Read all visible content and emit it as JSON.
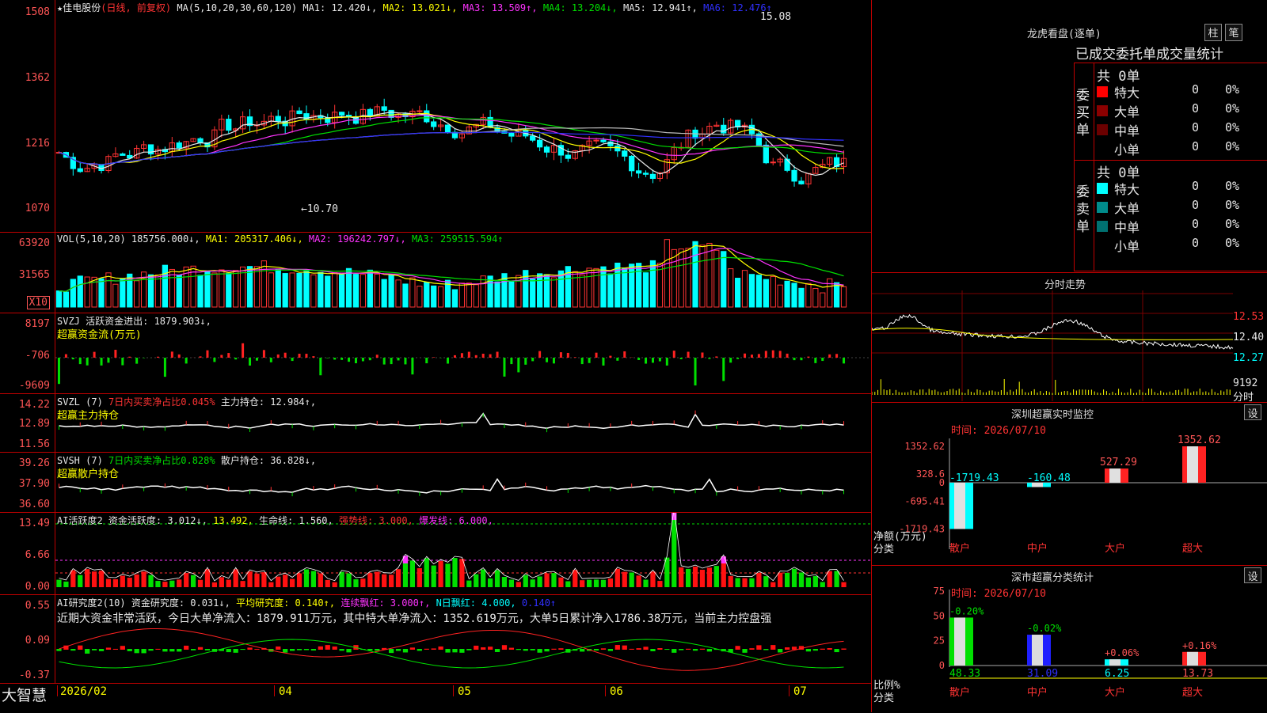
{
  "app": {
    "name": "大智慧"
  },
  "stock": {
    "star": "★",
    "name": "佳电股份",
    "mode": "(日线, 前复权)"
  },
  "ma_header": [
    {
      "text": "MA(5,10,20,30,60,120)",
      "color": "#e8e8e8"
    },
    {
      "text": "MA1: 12.420↓,",
      "color": "#e8e8e8"
    },
    {
      "text": "MA2: 13.021↓,",
      "color": "#ffff00"
    },
    {
      "text": "MA3: 13.509↑,",
      "color": "#ff33ff"
    },
    {
      "text": "MA4: 13.204↓,",
      "color": "#00e000"
    },
    {
      "text": "MA5: 12.941↑,",
      "color": "#e8e8e8"
    },
    {
      "text": "MA6: 12.476↑",
      "color": "#3030ff"
    }
  ],
  "price_axis": [
    "1508",
    "1362",
    "1216",
    "1070"
  ],
  "annotations": {
    "high": "15.08",
    "low": "←10.70"
  },
  "vol_header": [
    {
      "text": "VOL(5,10,20)",
      "color": "#e8e8e8"
    },
    {
      "text": "185756.000↓,",
      "color": "#e8e8e8"
    },
    {
      "text": "MA1: 205317.406↓,",
      "color": "#ffff00"
    },
    {
      "text": "MA2: 196242.797↓,",
      "color": "#ff33ff"
    },
    {
      "text": "MA3: 259515.594↑",
      "color": "#00e000"
    }
  ],
  "vol_axis": [
    "63920",
    "31565",
    "X10"
  ],
  "svzj": {
    "line1": "SVZJ  活跃资金进出: 1879.903↓,",
    "line2": "超赢资金流(万元)",
    "axis": [
      "8197",
      "-706",
      "-9609"
    ]
  },
  "svzl": {
    "a": "SVZL (7)",
    "b": "7日内买卖净占比0.045%",
    "c": "主力持仓: 12.984↑,",
    "line2": "超赢主力持仓",
    "axis": [
      "14.22",
      "12.89",
      "11.56"
    ]
  },
  "svsh": {
    "a": "SVSH (7)",
    "b": "7日内买卖净占比0.828%",
    "c": "散户持仓: 36.828↓,",
    "line2": "超赢散户持仓",
    "axis": [
      "39.26",
      "37.90",
      "36.60"
    ]
  },
  "ai1": {
    "header": [
      {
        "text": "AI活跃度2",
        "color": "#e8e8e8"
      },
      {
        "text": "资金活跃度: 3.012↓,",
        "color": "#e8e8e8"
      },
      {
        "text": "13.492,",
        "color": "#ffff00"
      },
      {
        "text": "生命线: 1.560,",
        "color": "#e8e8e8"
      },
      {
        "text": "强势线: 3.000,",
        "color": "#ff3333"
      },
      {
        "text": "爆发线: 6.000,",
        "color": "#ff33ff"
      }
    ],
    "axis": [
      "13.49",
      "6.66",
      "0.00"
    ]
  },
  "ai2": {
    "header": [
      {
        "text": "AI研究度2(10)",
        "color": "#e8e8e8"
      },
      {
        "text": "资金研究度: 0.031↓,",
        "color": "#e8e8e8"
      },
      {
        "text": "平均研究度: 0.140↑,",
        "color": "#ffff00"
      },
      {
        "text": "连续飘红: 3.000↑,",
        "color": "#ff33ff"
      },
      {
        "text": "N日飘红: 4.000,",
        "color": "#00ffff"
      },
      {
        "text": "0.140↑",
        "color": "#3030ff"
      }
    ],
    "comment": "近期大资金非常活跃，今日大单净流入：1879.911万元，其中特大单净流入：1352.619万元，大单5日累计净入1786.38万元，当前主力控盘强",
    "axis": [
      "0.55",
      "0.09",
      "-0.37"
    ]
  },
  "date_axis": [
    "2026/02",
    "04",
    "05",
    "06",
    "07"
  ],
  "longhu": {
    "title": "龙虎看盘(逐单)",
    "btn1": "柱",
    "btn2": "笔",
    "subtitle": "已成交委托单成交量统计",
    "buy": {
      "side": "委买单",
      "total": "共 0单",
      "rows": [
        {
          "name": "特大",
          "val": "0",
          "pct": "0%",
          "color": "#ff0000"
        },
        {
          "name": "大单",
          "val": "0",
          "pct": "0%",
          "color": "#8b0000"
        },
        {
          "name": "中单",
          "val": "0",
          "pct": "0%",
          "color": "#6b0000"
        },
        {
          "name": "小单",
          "val": "0",
          "pct": "0%",
          "color": ""
        }
      ]
    },
    "sell": {
      "side": "委卖单",
      "total": "共 0单",
      "rows": [
        {
          "name": "特大",
          "val": "0",
          "pct": "0%",
          "color": "#00ffff"
        },
        {
          "name": "大单",
          "val": "0",
          "pct": "0%",
          "color": "#008b8b"
        },
        {
          "name": "中单",
          "val": "0",
          "pct": "0%",
          "color": "#007070"
        },
        {
          "name": "小单",
          "val": "0",
          "pct": "0%",
          "color": ""
        }
      ]
    }
  },
  "intraday": {
    "title": "分时走势",
    "axis": [
      "12.53",
      "12.40",
      "12.27",
      "9192"
    ],
    "unit": "分时"
  },
  "monitor": {
    "title": "深圳超赢实时监控",
    "btn": "设",
    "time": "时间: 2026/07/10",
    "axis": [
      "1352.62",
      "328.6",
      "0",
      "-695.41",
      "-1719.43"
    ],
    "ylabel": "净额(万元)",
    "xlabel": "分类",
    "categories": [
      "散户",
      "中户",
      "大户",
      "超大"
    ],
    "values": [
      -1719.43,
      -160.48,
      527.29,
      1352.62
    ],
    "labels": [
      "-1719.43",
      "-160.48",
      "527.29",
      "1352.62"
    ]
  },
  "classify": {
    "title": "深市超赢分类统计",
    "btn": "设",
    "time": "时间: 2026/07/10",
    "axis": [
      "75",
      "50",
      "25",
      "0"
    ],
    "ylabel": "比例%",
    "xlabel": "分类",
    "categories": [
      "散户",
      "中户",
      "大户",
      "超大"
    ],
    "values": [
      48.33,
      31.09,
      6.25,
      13.73
    ],
    "top_labels": [
      "-0.20%",
      "-0.02%",
      "+0.06%",
      "+0.16%"
    ],
    "bottom_labels": [
      "48.33",
      "31.09",
      "6.25",
      "13.73"
    ]
  },
  "chart_data": [
    {
      "type": "candlestick",
      "title": "佳电股份 (日线, 前复权)",
      "ylim": [
        10.7,
        15.08
      ],
      "x_ticks": [
        "2026/02",
        "04",
        "05",
        "06",
        "07"
      ],
      "high": 15.08,
      "low": 10.7,
      "last_ma": {
        "MA1": 12.42,
        "MA2": 13.021,
        "MA3": 13.509,
        "MA4": 13.204,
        "MA5": 12.941,
        "MA6": 12.476
      }
    },
    {
      "type": "bar",
      "title": "VOL(5,10,20)",
      "last": 185756.0,
      "ma": {
        "MA1": 205317.406,
        "MA2": 196242.797,
        "MA3": 259515.594
      },
      "ylim": [
        0,
        63920
      ]
    },
    {
      "type": "bar",
      "title": "深圳超赢实时监控",
      "categories": [
        "散户",
        "中户",
        "大户",
        "超大"
      ],
      "values": [
        -1719.43,
        -160.48,
        527.29,
        1352.62
      ],
      "ylabel": "净额(万元)",
      "xlabel": "分类"
    },
    {
      "type": "bar",
      "title": "深市超赢分类统计",
      "categories": [
        "散户",
        "中户",
        "大户",
        "超大"
      ],
      "values": [
        48.33,
        31.09,
        6.25,
        13.73
      ],
      "ylabel": "比例%",
      "xlabel": "分类",
      "ylim": [
        0,
        75
      ]
    }
  ]
}
